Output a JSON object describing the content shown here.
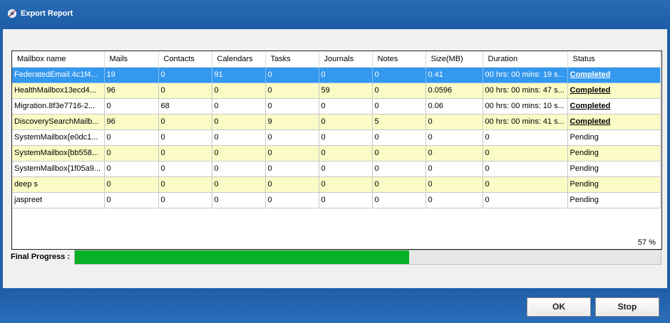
{
  "window": {
    "title": "Export Report",
    "icon": "app-gear-icon"
  },
  "table": {
    "columns": [
      "Mailbox name",
      "Mails",
      "Contacts",
      "Calendars",
      "Tasks",
      "Journals",
      "Notes",
      "Size(MB)",
      "Duration",
      "Status"
    ],
    "rows": [
      {
        "name": "FederatedEmail.4c1f4...",
        "mails": "19",
        "contacts": "0",
        "calendars": "91",
        "tasks": "0",
        "journals": "0",
        "notes": "0",
        "size": "0.41",
        "duration": "00 hrs: 00 mins: 19 s...",
        "status": "Completed",
        "selected": true
      },
      {
        "name": "HealthMailbox13ecd4...",
        "mails": "96",
        "contacts": "0",
        "calendars": "0",
        "tasks": "0",
        "journals": "59",
        "notes": "0",
        "size": "0.0596",
        "duration": "00 hrs: 00 mins: 47 s...",
        "status": "Completed"
      },
      {
        "name": "Migration.8f3e7716-2...",
        "mails": "0",
        "contacts": "68",
        "calendars": "0",
        "tasks": "0",
        "journals": "0",
        "notes": "0",
        "size": "0.06",
        "duration": "00 hrs: 00 mins: 10 s...",
        "status": "Completed"
      },
      {
        "name": "DiscoverySearchMailb...",
        "mails": "96",
        "contacts": "0",
        "calendars": "0",
        "tasks": "9",
        "journals": "0",
        "notes": "5",
        "size": "0",
        "duration": "00 hrs: 00 mins: 41 s...",
        "status": "Completed"
      },
      {
        "name": "SystemMailbox{e0dc1...",
        "mails": "0",
        "contacts": "0",
        "calendars": "0",
        "tasks": "0",
        "journals": "0",
        "notes": "0",
        "size": "0",
        "duration": "0",
        "status": "Pending"
      },
      {
        "name": "SystemMailbox{bb558...",
        "mails": "0",
        "contacts": "0",
        "calendars": "0",
        "tasks": "0",
        "journals": "0",
        "notes": "0",
        "size": "0",
        "duration": "0",
        "status": "Pending"
      },
      {
        "name": "SystemMailbox{1f05a9...",
        "mails": "0",
        "contacts": "0",
        "calendars": "0",
        "tasks": "0",
        "journals": "0",
        "notes": "0",
        "size": "0",
        "duration": "0",
        "status": "Pending"
      },
      {
        "name": "deep s",
        "mails": "0",
        "contacts": "0",
        "calendars": "0",
        "tasks": "0",
        "journals": "0",
        "notes": "0",
        "size": "0",
        "duration": "0",
        "status": "Pending"
      },
      {
        "name": "jaspreet",
        "mails": "0",
        "contacts": "0",
        "calendars": "0",
        "tasks": "0",
        "journals": "0",
        "notes": "0",
        "size": "0",
        "duration": "0",
        "status": "Pending"
      }
    ]
  },
  "progress": {
    "label": "Final Progress :",
    "percent_text": "57 %",
    "value": 0.57,
    "color": "#06b025"
  },
  "buttons": {
    "ok": "OK",
    "stop": "Stop"
  },
  "colors": {
    "title_bar": "#1e5ea9",
    "row_selected": "#3398ee",
    "row_alt": "#fbfbc6"
  }
}
